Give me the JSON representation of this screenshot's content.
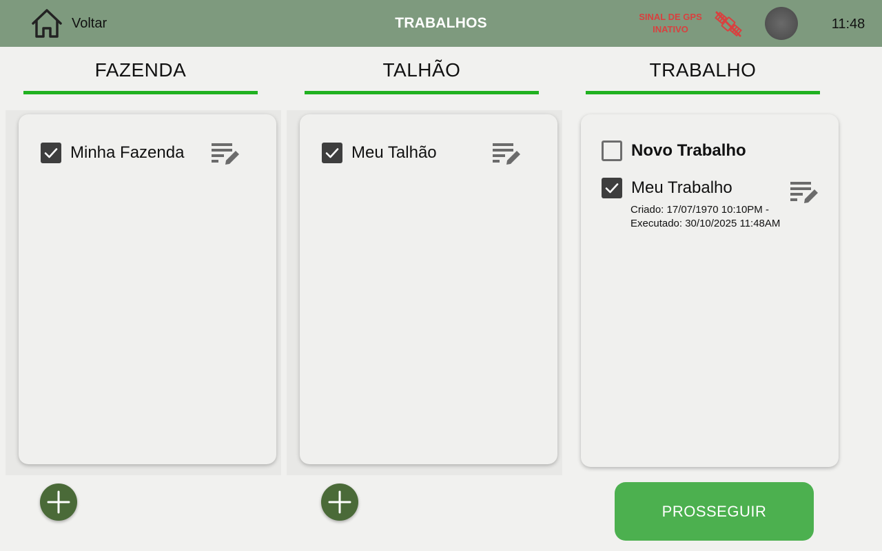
{
  "header": {
    "back_label": "Voltar",
    "title": "TRABALHOS",
    "gps_status_line1": "SINAL DE GPS",
    "gps_status_line2": "INATIVO",
    "time": "11:48",
    "icons": [
      "home-icon",
      "gps-off-icon",
      "status-indicator"
    ]
  },
  "columns": {
    "farm": {
      "header": "FAZENDA",
      "items": [
        {
          "label": "Minha Fazenda",
          "checked": true
        }
      ]
    },
    "plot": {
      "header": "TALHÃO",
      "items": [
        {
          "label": "Meu Talhão",
          "checked": true
        }
      ]
    },
    "job": {
      "header": "TRABALHO",
      "new_item": {
        "label": "Novo Trabalho",
        "checked": false
      },
      "items": [
        {
          "label": "Meu Trabalho",
          "checked": true,
          "created": "Criado: 17/07/1970 10:10PM  -",
          "executed": "Executado: 30/10/2025 11:48AM"
        }
      ]
    }
  },
  "actions": {
    "proceed_label": "PROSSEGUIR",
    "add_icon": "plus-icon"
  },
  "colors": {
    "topbar": "#7e9a7e",
    "accent_underline": "#20b120",
    "gps_warning": "#d9403f",
    "add_button": "#4a6a38",
    "proceed_button": "#4cb04f"
  }
}
